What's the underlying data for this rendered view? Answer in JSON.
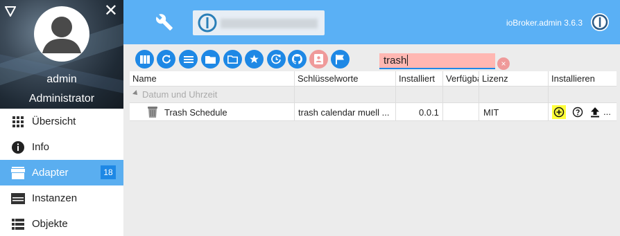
{
  "user": {
    "name": "admin",
    "role": "Administrator"
  },
  "nav": {
    "items": [
      {
        "label": "Übersicht",
        "icon": "grid-icon"
      },
      {
        "label": "Info",
        "icon": "info-icon"
      },
      {
        "label": "Adapter",
        "icon": "store-icon",
        "badge": "18",
        "active": true
      },
      {
        "label": "Instanzen",
        "icon": "instances-icon"
      },
      {
        "label": "Objekte",
        "icon": "list-icon"
      }
    ]
  },
  "topbar": {
    "version": "ioBroker.admin 3.6.3"
  },
  "toolbar": {
    "search_value": "trash",
    "clear_label": "×",
    "buttons": [
      "tiles-view-icon",
      "refresh-icon",
      "list-view-icon",
      "folder-icon",
      "folder-open-icon",
      "star-icon",
      "update-check-icon",
      "github-icon",
      "contact-icon",
      "flag-icon"
    ]
  },
  "table": {
    "headers": [
      "Name",
      "Schlüsselworte",
      "Installiert",
      "Verfügbar",
      "Lizenz",
      "Installieren"
    ],
    "group": "Datum und Uhrzeit",
    "rows": [
      {
        "name": "Trash Schedule",
        "keywords": "trash calendar muell ...",
        "installed": "0.0.1",
        "available": "",
        "license": "MIT",
        "more": "..."
      }
    ]
  },
  "colors": {
    "accent": "#1e88e5",
    "topbar": "#5ab0f5",
    "active_nav": "#5aaef0",
    "search_bg": "#ffb7b2",
    "highlight": "#ffff3a"
  }
}
